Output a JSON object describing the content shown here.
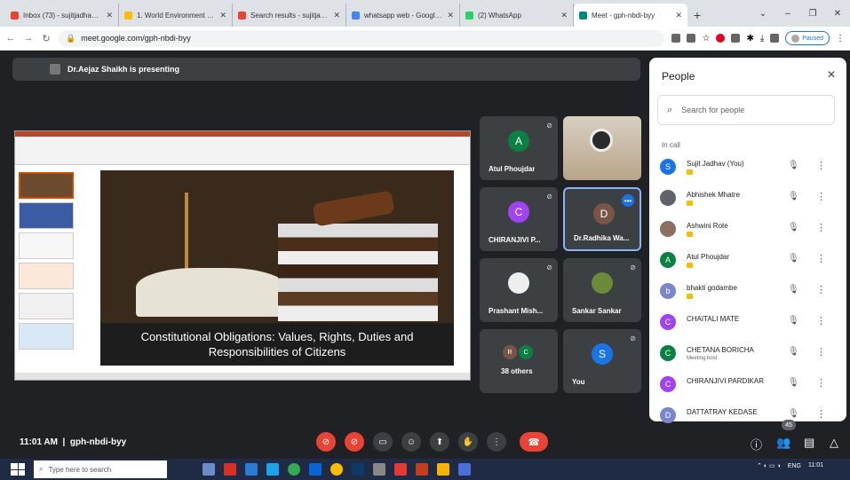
{
  "browser": {
    "tabs": [
      {
        "title": "Inbox (73) - sujitjadhav@...",
        "color": "#ea4335",
        "icon": "gmail-icon"
      },
      {
        "title": "1. World Environment Day",
        "color": "#fbbc04",
        "icon": "drive-icon"
      },
      {
        "title": "Search results - sujitjadh...",
        "color": "#ea4335",
        "icon": "gmail-icon"
      },
      {
        "title": "whatsapp web - Google Se...",
        "color": "#4285f4",
        "icon": "google-icon"
      },
      {
        "title": "(2) WhatsApp",
        "color": "#25d366",
        "icon": "whatsapp-icon"
      },
      {
        "title": "Meet - gph-nbdi-byy",
        "color": "#00897b",
        "icon": "meet-icon",
        "active": true
      }
    ],
    "url": "meet.google.com/gph-nbdi-byy",
    "profile_label": "Paused"
  },
  "meet": {
    "presenter_text": "Dr.Aejaz Shaikh is presenting",
    "slide_caption": "Constitutional Obligations: Values, Rights, Duties and Responsibilities of Citizens",
    "tiles": [
      {
        "name": "Atul Phoujdar",
        "initial": "A",
        "color": "#0b8043"
      },
      {
        "name": "CHIRANJIVI P...",
        "initial": "C",
        "color": "#a142f4"
      },
      {
        "name": "Dr.Radhika Wa...",
        "initial": "D",
        "color": "#795548"
      },
      {
        "name": "Prashant Mish...",
        "initial": "",
        "color": "#3c4043"
      },
      {
        "name": "Sankar Sankar",
        "initial": "",
        "color": "#3c4043"
      },
      {
        "name": "38 others",
        "initial": "RC",
        "color": "#795548"
      },
      {
        "name": "You",
        "initial": "S",
        "color": "#1a73e8"
      }
    ],
    "more_badge": "•••",
    "time": "11:01 AM",
    "separator": "|",
    "meeting_code": "gph-nbdi-byy",
    "participant_count": "45"
  },
  "people": {
    "title": "People",
    "search_placeholder": "Search for people",
    "section": "In call",
    "list": [
      {
        "name": "Sujit Jadhav (You)",
        "initial": "S",
        "color": "#1a73e8",
        "badge": true
      },
      {
        "name": "Abhishek Mhatre",
        "initial": "",
        "color": "#5f6368",
        "badge": true
      },
      {
        "name": "Ashwini Rote",
        "initial": "",
        "color": "#8d6e63",
        "badge": true
      },
      {
        "name": "Atul Phoujdar",
        "initial": "A",
        "color": "#0b8043",
        "badge": true
      },
      {
        "name": "bhakti godambe",
        "initial": "b",
        "color": "#7986cb",
        "badge": true
      },
      {
        "name": "CHAITALI MATE",
        "initial": "C",
        "color": "#a142f4",
        "badge": false
      },
      {
        "name": "CHETANA BORICHA",
        "sub": "Meeting host",
        "initial": "C",
        "color": "#0b8043",
        "badge": false
      },
      {
        "name": "CHIRANJIVI PARDIKAR",
        "initial": "C",
        "color": "#a142f4",
        "badge": false
      },
      {
        "name": "DATTATRAY KEDASE",
        "initial": "D",
        "color": "#7986cb",
        "badge": false
      }
    ]
  },
  "taskbar": {
    "search_placeholder": "Type here to search",
    "lang": "ENG",
    "time": "11:01"
  }
}
